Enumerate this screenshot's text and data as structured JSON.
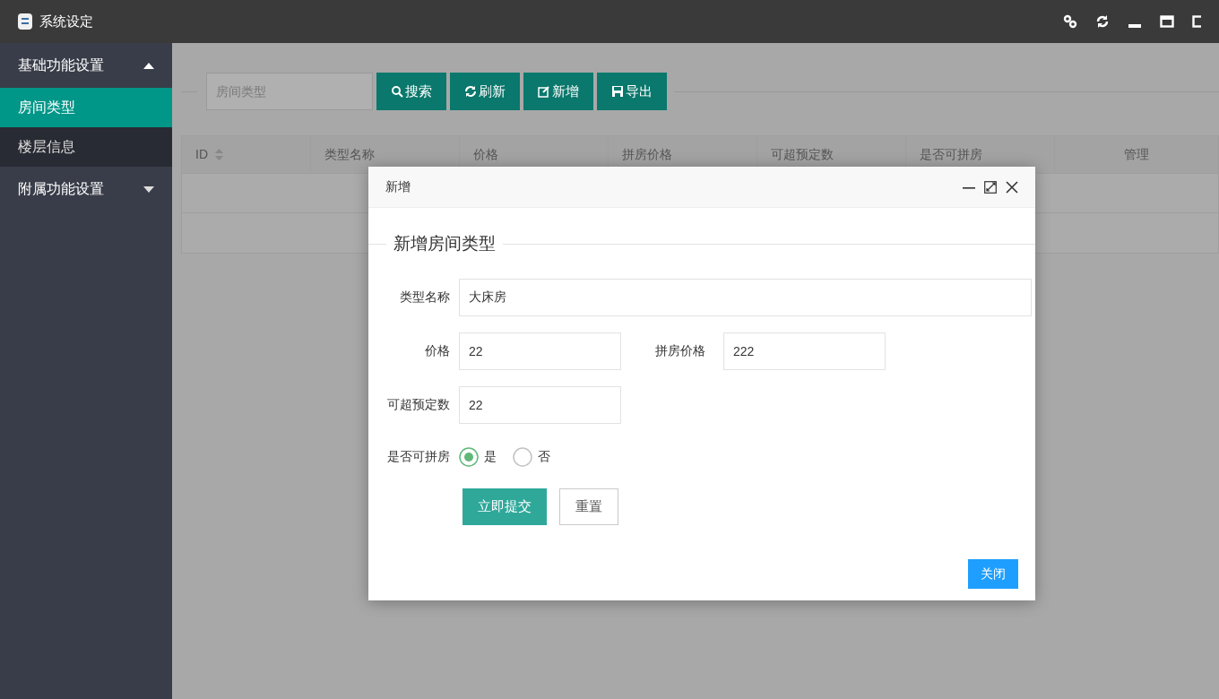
{
  "window": {
    "title": "系统设定"
  },
  "sidebar": {
    "groups": [
      {
        "label": "基础功能设置",
        "expanded": true,
        "children": [
          {
            "label": "房间类型",
            "selected": true
          },
          {
            "label": "楼层信息",
            "selected": false
          }
        ]
      },
      {
        "label": "附属功能设置",
        "expanded": false
      }
    ]
  },
  "toolbar": {
    "search": {
      "placeholder": "房间类型"
    },
    "buttons": [
      {
        "kind": "search",
        "label": "搜索"
      },
      {
        "kind": "refresh",
        "label": "刷新"
      },
      {
        "kind": "add",
        "label": "新增"
      },
      {
        "kind": "export",
        "label": "导出"
      }
    ]
  },
  "table": {
    "columns": [
      {
        "label": "ID",
        "sortable": true
      },
      {
        "label": "类型名称",
        "sortable": false
      },
      {
        "label": "价格",
        "sortable": false
      },
      {
        "label": "拼房价格",
        "sortable": false
      },
      {
        "label": "可超预定数",
        "sortable": false
      },
      {
        "label": "是否可拼房",
        "sortable": false
      },
      {
        "label": "管理",
        "sortable": false
      }
    ]
  },
  "dialog": {
    "title": "新增",
    "legend": "新增房间类型",
    "rows": [
      [
        {
          "label": "类型名称",
          "value": "大床房",
          "wide": true
        }
      ],
      [
        {
          "label": "价格",
          "value": "22",
          "wide": false
        },
        {
          "label": "拼房价格",
          "value": "222",
          "wide": false
        }
      ],
      [
        {
          "label": "可超预定数",
          "value": "22",
          "wide": false
        }
      ]
    ],
    "radio": {
      "label": "是否可拼房",
      "options": [
        {
          "label": "是",
          "selected": true
        },
        {
          "label": "否",
          "selected": false
        }
      ]
    },
    "buttons": [
      {
        "kind": "primary",
        "label": "立即提交"
      },
      {
        "kind": "default",
        "label": "重置"
      }
    ],
    "close_button": "关闭"
  }
}
